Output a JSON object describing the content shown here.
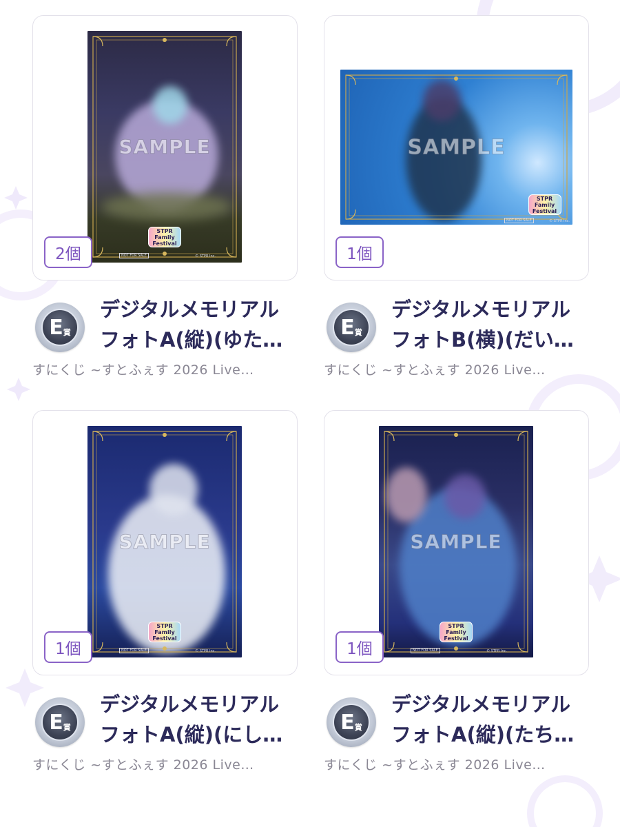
{
  "items": [
    {
      "title_line1": "デジタルメモリアル",
      "title_line2": "フォトA(縦)(ゆた…",
      "subtitle": "すにくじ ~すとふぇす 2026 Live…",
      "count": "2個",
      "prize_letter": "E",
      "prize_suffix": "賞",
      "watermark": "SAMPLE",
      "logo_text": "STPR Family Festival",
      "not_for_sale": "NOT FOR SALE",
      "copyright": "© STPR Inc.",
      "orientation": "portrait"
    },
    {
      "title_line1": "デジタルメモリアル",
      "title_line2": "フォトB(横)(だい…",
      "subtitle": "すにくじ ~すとふぇす 2026 Live…",
      "count": "1個",
      "prize_letter": "E",
      "prize_suffix": "賞",
      "watermark": "SAMPLE",
      "logo_text": "STPR Family Festival",
      "not_for_sale": "NOT FOR SALE",
      "copyright": "© STPR Inc.",
      "orientation": "landscape"
    },
    {
      "title_line1": "デジタルメモリアル",
      "title_line2": "フォトA(縦)(にし…",
      "subtitle": "すにくじ ~すとふぇす 2026 Live…",
      "count": "1個",
      "prize_letter": "E",
      "prize_suffix": "賞",
      "watermark": "SAMPLE",
      "logo_text": "STPR Family Festival",
      "not_for_sale": "NOT FOR SALE",
      "copyright": "© STPR Inc.",
      "orientation": "portrait"
    },
    {
      "title_line1": "デジタルメモリアル",
      "title_line2": "フォトA(縦)(たち…",
      "subtitle": "すにくじ ~すとふぇす 2026 Live…",
      "count": "1個",
      "prize_letter": "E",
      "prize_suffix": "賞",
      "watermark": "SAMPLE",
      "logo_text": "STPR Family Festival",
      "not_for_sale": "NOT FOR SALE",
      "copyright": "© STPR Inc.",
      "orientation": "portrait"
    }
  ],
  "colors": {
    "count_border": "#8a63c7",
    "count_text": "#7d55bf",
    "title_text": "#2c2a5a",
    "subtitle_text": "#8a8794",
    "card_border": "#e3e1ea"
  }
}
